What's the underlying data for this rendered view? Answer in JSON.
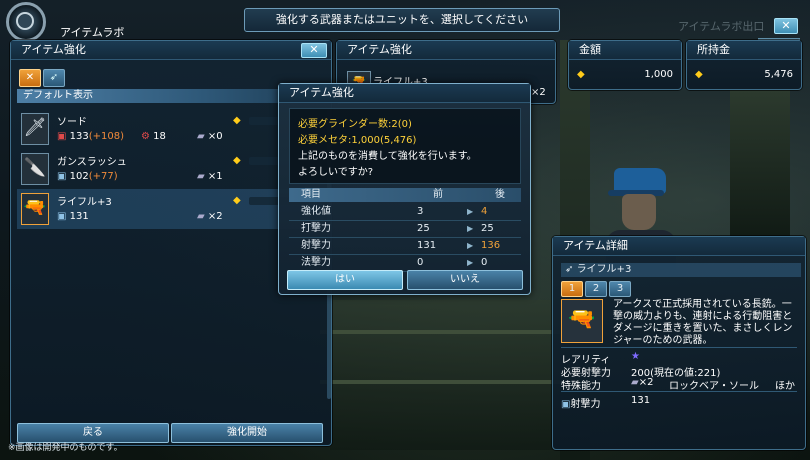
{
  "header": {
    "lab_title": "アイテムラボ",
    "instruction": "強化する武器またはユニットを、選択してください",
    "ghost_text": "アイテムラボ出口",
    "close_label": "✕"
  },
  "left_panel": {
    "title": "アイテム強化",
    "close_label": "✕",
    "tabs": [
      {
        "icon": "sword-tab-icon",
        "glyph": "✕"
      },
      {
        "icon": "gun-tab-icon",
        "glyph": "➶"
      }
    ],
    "default_view": "デフォルト表示",
    "items": [
      {
        "name": "ソード",
        "attack": "133",
        "attack_bonus": "(+108)",
        "stat2": "18",
        "count": "×0",
        "selected": false
      },
      {
        "name": "ガンスラッシュ",
        "attack": "102",
        "attack_bonus": "(+77)",
        "stat2": "",
        "count": "×1",
        "selected": false
      },
      {
        "name": "ライフル+3",
        "attack": "131",
        "attack_bonus": "",
        "stat2": "",
        "count": "×2",
        "selected": true
      }
    ],
    "back_button": "戻る",
    "start_button": "強化開始"
  },
  "middle_panel": {
    "title": "アイテム強化",
    "item_name": "ライフル+3",
    "count": "×2"
  },
  "money": {
    "required_title": "金額",
    "required_value": "1,000",
    "owned_title": "所持金",
    "owned_value": "5,476"
  },
  "modal": {
    "title": "アイテム強化",
    "line1": "必要グラインダー数:2(0)",
    "line2": "必要メセタ:1,000(5,476)",
    "line3": "上記のものを消費して強化を行います。",
    "line4": "よろしいですか?",
    "table": {
      "headers": [
        "項目",
        "前",
        "後"
      ],
      "rows": [
        {
          "label": "強化値",
          "before": "3",
          "after": "4",
          "highlight": true
        },
        {
          "label": "打撃力",
          "before": "25",
          "after": "25",
          "highlight": false
        },
        {
          "label": "射撃力",
          "before": "131",
          "after": "136",
          "highlight": true
        },
        {
          "label": "法撃力",
          "before": "0",
          "after": "0",
          "highlight": false
        }
      ]
    },
    "yes_button": "はい",
    "no_button": "いいえ"
  },
  "details": {
    "title": "アイテム詳細",
    "item_name": "ライフル+3",
    "level_tabs": [
      "1",
      "2",
      "3"
    ],
    "description": "アークスで正式採用されている長銃。一撃の威力よりも、連射による行動阻害とダメージに重きを置いた、まさしくレンジャーのための武器。",
    "rarity_label": "レアリティ",
    "rarity_value": "★",
    "req_label": "必要射撃力",
    "req_value": "200(現在の値:221)",
    "special_label": "特殊能力",
    "special_count": "×2",
    "special_value": "ロックベア・ソール",
    "special_more": "ほか",
    "shot_label": "射撃力",
    "shot_value": "131"
  },
  "footnote": "※画像は開発中のものです。",
  "colors": {
    "accent_orange": "#f0a23a",
    "plus_orange": "#f08a3a",
    "yellow_text": "#ffd23a",
    "gold_diamond": "#ffcc1a",
    "button_blue": "#4a82a8",
    "panel_border": "#3e6d8a"
  }
}
